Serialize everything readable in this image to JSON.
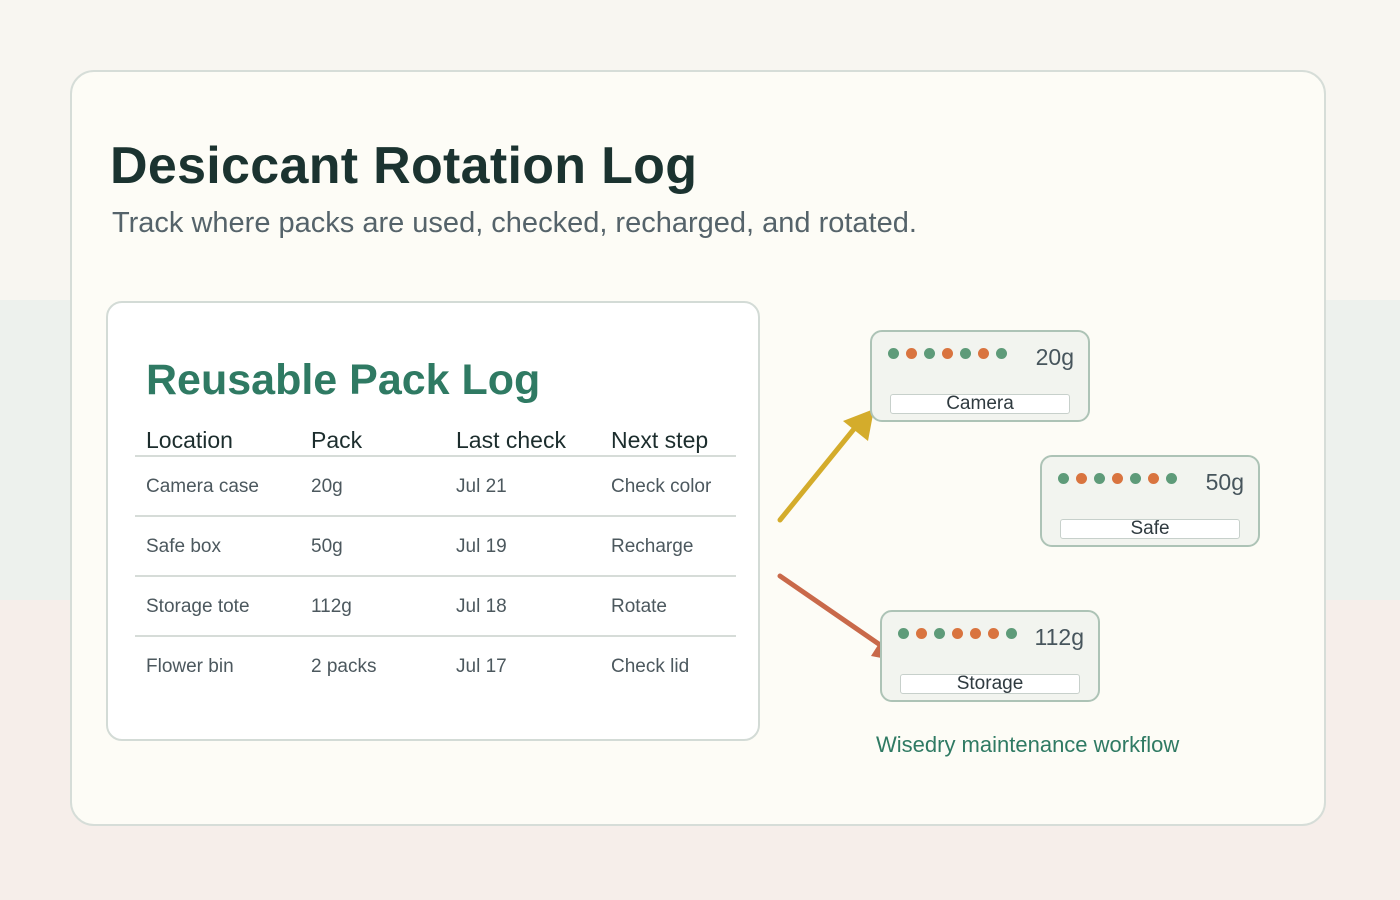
{
  "title": "Desiccant Rotation Log",
  "subtitle": "Track where packs are used, checked, recharged, and rotated.",
  "log": {
    "title": "Reusable Pack Log",
    "columns": [
      "Location",
      "Pack",
      "Last check",
      "Next step"
    ],
    "rows": [
      [
        "Camera case",
        "20g",
        "Jul 21",
        "Check color"
      ],
      [
        "Safe box",
        "50g",
        "Jul 19",
        "Recharge"
      ],
      [
        "Storage tote",
        "112g",
        "Jul 18",
        "Rotate"
      ],
      [
        "Flower bin",
        "2 packs",
        "Jul 17",
        "Check lid"
      ]
    ]
  },
  "packs": [
    {
      "weight": "20g",
      "label": "Camera",
      "beads": [
        "green",
        "orange",
        "green",
        "orange",
        "green",
        "orange",
        "green"
      ]
    },
    {
      "weight": "50g",
      "label": "Safe",
      "beads": [
        "green",
        "orange",
        "green",
        "orange",
        "green",
        "orange",
        "green"
      ]
    },
    {
      "weight": "112g",
      "label": "Storage",
      "beads": [
        "green",
        "orange",
        "green",
        "orange",
        "orange",
        "orange",
        "green"
      ]
    }
  ],
  "arrows": [
    {
      "to": "Camera",
      "color": "#d4ac2b"
    },
    {
      "to": "Storage",
      "color": "#c9694a"
    }
  ],
  "caption": "Wisedry maintenance workflow",
  "colors": {
    "accent_green": "#2f7a63",
    "bead_green": "#5e9b79",
    "bead_orange": "#d9743f",
    "title": "#1b3330"
  }
}
